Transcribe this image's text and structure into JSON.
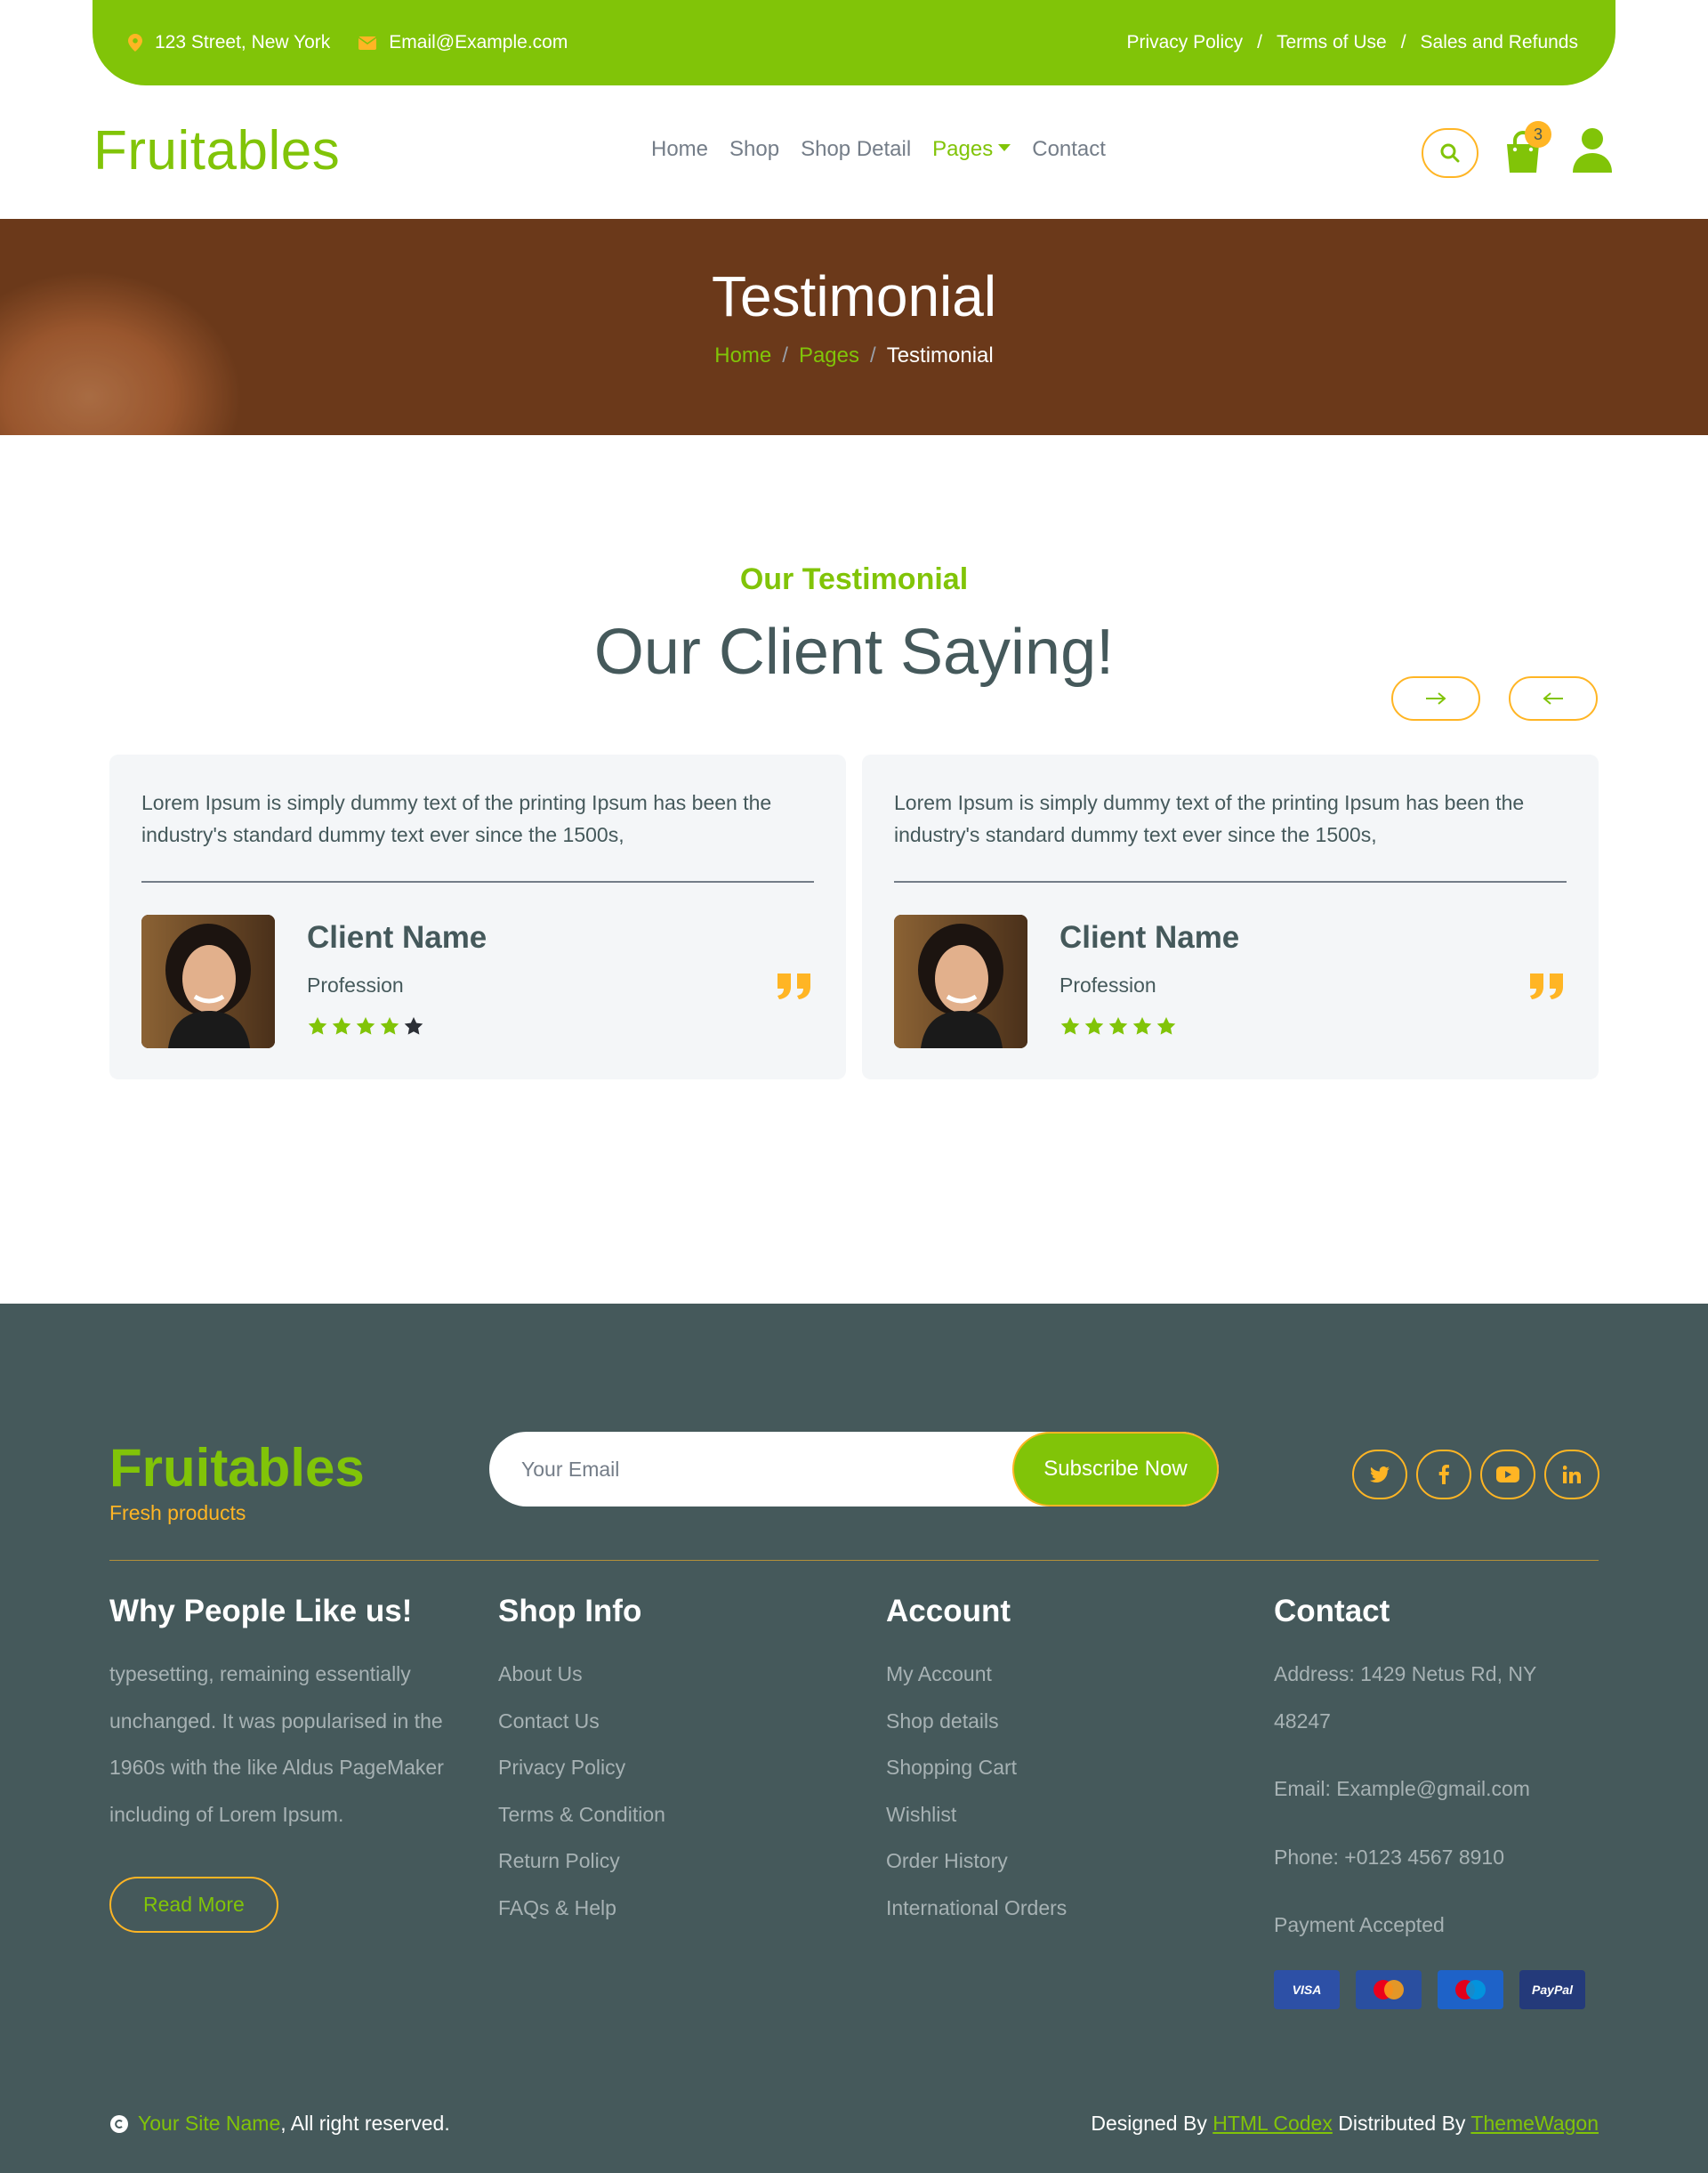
{
  "topbar": {
    "address": "123 Street, New York",
    "email": "Email@Example.com",
    "links": [
      "Privacy Policy",
      "Terms of Use",
      "Sales and Refunds"
    ],
    "separator": "/"
  },
  "navbar": {
    "brand": "Fruitables",
    "menu": [
      "Home",
      "Shop",
      "Shop Detail",
      "Pages",
      "Contact"
    ],
    "active": "Pages",
    "cart_count": "3"
  },
  "hero": {
    "title": "Testimonial",
    "breadcrumb": [
      "Home",
      "Pages",
      "Testimonial"
    ],
    "separator": "/"
  },
  "testimonial": {
    "subtitle": "Our Testimonial",
    "title": "Our Client Saying!",
    "cards": [
      {
        "text": "Lorem Ipsum is simply dummy text of the printing Ipsum has been the industry's standard dummy text ever since the 1500s,",
        "name": "Client Name",
        "profession": "Profession",
        "rating": 4
      },
      {
        "text": "Lorem Ipsum is simply dummy text of the printing Ipsum has been the industry's standard dummy text ever since the 1500s,",
        "name": "Client Name",
        "profession": "Profession",
        "rating": 5
      }
    ]
  },
  "footer": {
    "brand": "Fruitables",
    "tagline": "Fresh products",
    "email_placeholder": "Your Email",
    "subscribe_label": "Subscribe Now",
    "socials": [
      "twitter-icon",
      "facebook-icon",
      "youtube-icon",
      "linkedin-icon"
    ],
    "why": {
      "heading": "Why People Like us!",
      "text": "typesetting, remaining essentially unchanged. It was popularised in the 1960s with the like Aldus PageMaker including of Lorem Ipsum.",
      "button": "Read More"
    },
    "shop": {
      "heading": "Shop Info",
      "links": [
        "About Us",
        "Contact Us",
        "Privacy Policy",
        "Terms & Condition",
        "Return Policy",
        "FAQs & Help"
      ]
    },
    "account": {
      "heading": "Account",
      "links": [
        "My Account",
        "Shop details",
        "Shopping Cart",
        "Wishlist",
        "Order History",
        "International Orders"
      ]
    },
    "contact": {
      "heading": "Contact",
      "address": "Address: 1429 Netus Rd, NY 48247",
      "email": "Email: Example@gmail.com",
      "phone": "Phone: +0123 4567 8910",
      "payment": "Payment Accepted",
      "cards": [
        "VISA",
        "MasterCard",
        "Maestro",
        "PayPal"
      ]
    },
    "copyright": {
      "site": "Your Site Name",
      "rest": ", All right reserved."
    },
    "credits": {
      "prefix": "Designed By ",
      "designer": "HTML Codex",
      "middle": " Distributed By ",
      "distributor": "ThemeWagon"
    }
  },
  "colors": {
    "primary": "#81c408",
    "secondary": "#ffb524",
    "dark": "#45595b",
    "light": "#f4f6f8"
  }
}
